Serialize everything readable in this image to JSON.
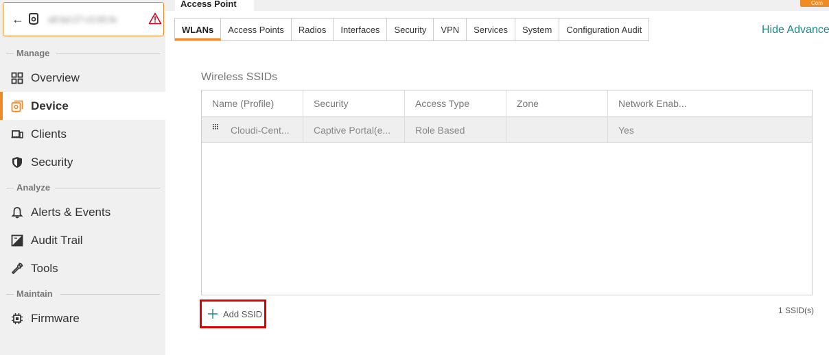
{
  "device": {
    "back_icon": "arrow-left-icon",
    "type_icon": "access-point-icon",
    "mac": "a8:bd:27:c5:65:fe",
    "alert_icon": "warning-triangle-icon",
    "alert_color": "#d9001b"
  },
  "sidebar": {
    "sections": {
      "manage": "Manage",
      "analyze": "Analyze",
      "maintain": "Maintain"
    },
    "items": [
      {
        "label": "Overview",
        "icon": "grid-icon"
      },
      {
        "label": "Device",
        "icon": "device-icon",
        "active": true
      },
      {
        "label": "Clients",
        "icon": "clients-icon"
      },
      {
        "label": "Security",
        "icon": "shield-icon"
      },
      {
        "label": "Alerts & Events",
        "icon": "bell-icon"
      },
      {
        "label": "Audit Trail",
        "icon": "audit-icon"
      },
      {
        "label": "Tools",
        "icon": "wrench-icon"
      },
      {
        "label": "Firmware",
        "icon": "chip-icon"
      }
    ]
  },
  "header": {
    "device_tab": "Access Point",
    "orange_button": "Com"
  },
  "tabs": [
    "WLANs",
    "Access Points",
    "Radios",
    "Interfaces",
    "Security",
    "VPN",
    "Services",
    "System",
    "Configuration Audit"
  ],
  "active_tab": "WLANs",
  "hide_advanced": "Hide Advanced",
  "wlans": {
    "title": "Wireless SSIDs",
    "columns": [
      "Name (Profile)",
      "Security",
      "Access Type",
      "Zone",
      "Network Enab..."
    ],
    "rows": [
      {
        "name": "Cloudi-Cent...",
        "security": "Captive Portal(e...",
        "access_type": "Role Based",
        "zone": "",
        "enabled": "Yes"
      }
    ],
    "add_label": "Add SSID",
    "count": "1 SSID(s)"
  },
  "colors": {
    "accent": "#f08a24",
    "link": "#1b8a87",
    "highlight_box": "#e00000"
  }
}
